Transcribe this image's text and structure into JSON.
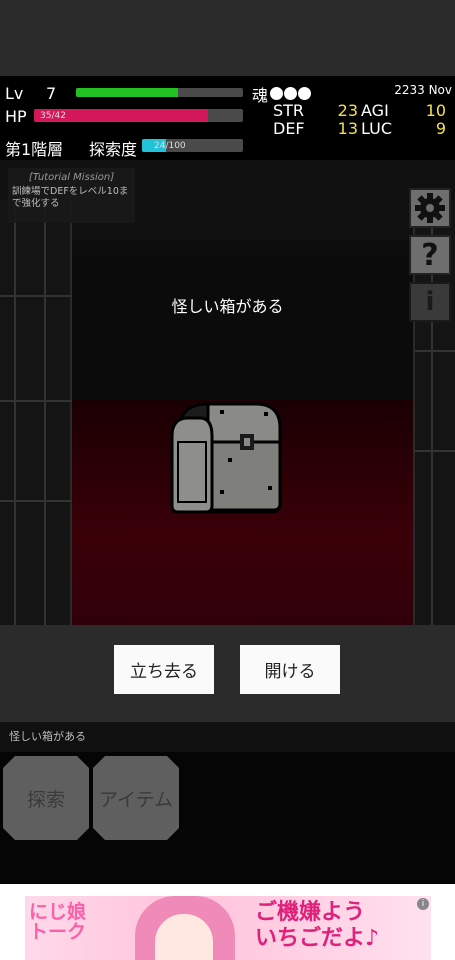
{
  "player": {
    "lv_label": "Lv",
    "lv_value": "7",
    "hp_label": "HP",
    "hp_text": "35/42",
    "hp_fraction": 0.833,
    "exp_fraction": 0.61,
    "soul_label": "魂",
    "soul_count": 3,
    "date": "2233 Nov"
  },
  "stats": {
    "str_label": "STR",
    "str_value": "23",
    "agi_label": "AGI",
    "agi_value": "10",
    "def_label": "DEF",
    "def_value": "13",
    "luc_label": "LUC",
    "luc_value": "9"
  },
  "floor": {
    "name": "第1階層",
    "explore_label": "探索度",
    "explore_text": "24/100",
    "explore_fraction": 0.24
  },
  "mission": {
    "title": "[Tutorial Mission]",
    "desc": "訓練場でDEFをレベル10まで強化する"
  },
  "side_buttons": {
    "settings_icon": "gear-icon",
    "help_icon": "help-icon",
    "info_icon": "info-icon",
    "help_glyph": "?",
    "info_glyph": "i"
  },
  "event": {
    "text": "怪しい箱がある"
  },
  "choices": {
    "leave": "立ち去る",
    "open": "開ける"
  },
  "log": {
    "line": "怪しい箱がある"
  },
  "actions": {
    "explore": "探索",
    "item": "アイテム"
  },
  "ad": {
    "text_left": "にじ娘\nトーク",
    "text_right": "ご機嫌よう\nいちごだよ♪",
    "info_glyph": "i"
  },
  "colors": {
    "exp": "#23c223",
    "hp": "#d4175a",
    "explore": "#22c3d8",
    "stat_value": "#f4e04d",
    "floor": "#3a0008"
  }
}
